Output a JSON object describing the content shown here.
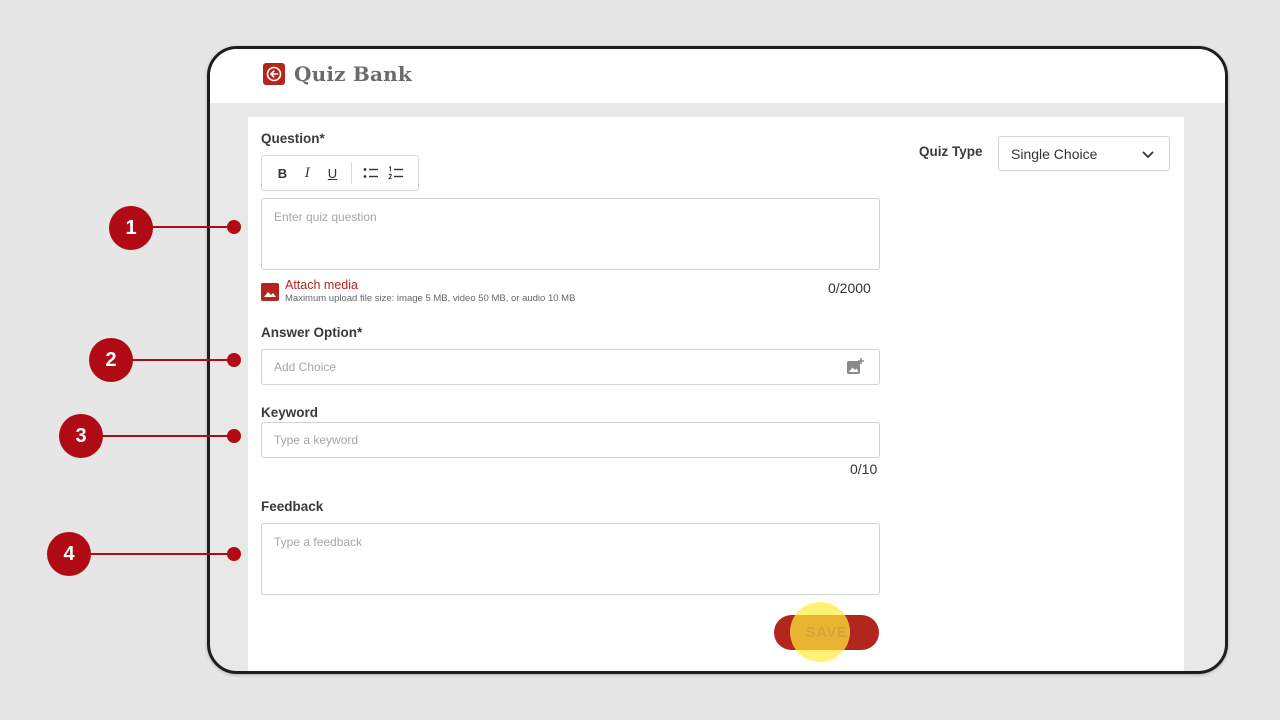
{
  "header": {
    "title": "Quiz Bank"
  },
  "form": {
    "question_label": "Question*",
    "toolbar": {
      "bold": "B",
      "italic": "I",
      "underline": "U"
    },
    "question_placeholder": "Enter quiz question",
    "attach_link": "Attach media",
    "attach_note": "Maximum upload file size: image 5 MB, video 50 MB, or audio 10 MB",
    "question_counter": "0/2000",
    "answer_label": "Answer Option*",
    "answer_placeholder": "Add Choice",
    "keyword_label": "Keyword",
    "keyword_placeholder": "Type a keyword",
    "keyword_counter": "0/10",
    "feedback_label": "Feedback",
    "feedback_placeholder": "Type a feedback",
    "save_label": "SAVE"
  },
  "quiz_type": {
    "label": "Quiz Type",
    "selected": "Single Choice"
  },
  "markers": [
    "1",
    "2",
    "3",
    "4"
  ],
  "colors": {
    "accent": "#b3261e",
    "marker": "#b00b14",
    "highlight": "#ffec3c"
  }
}
